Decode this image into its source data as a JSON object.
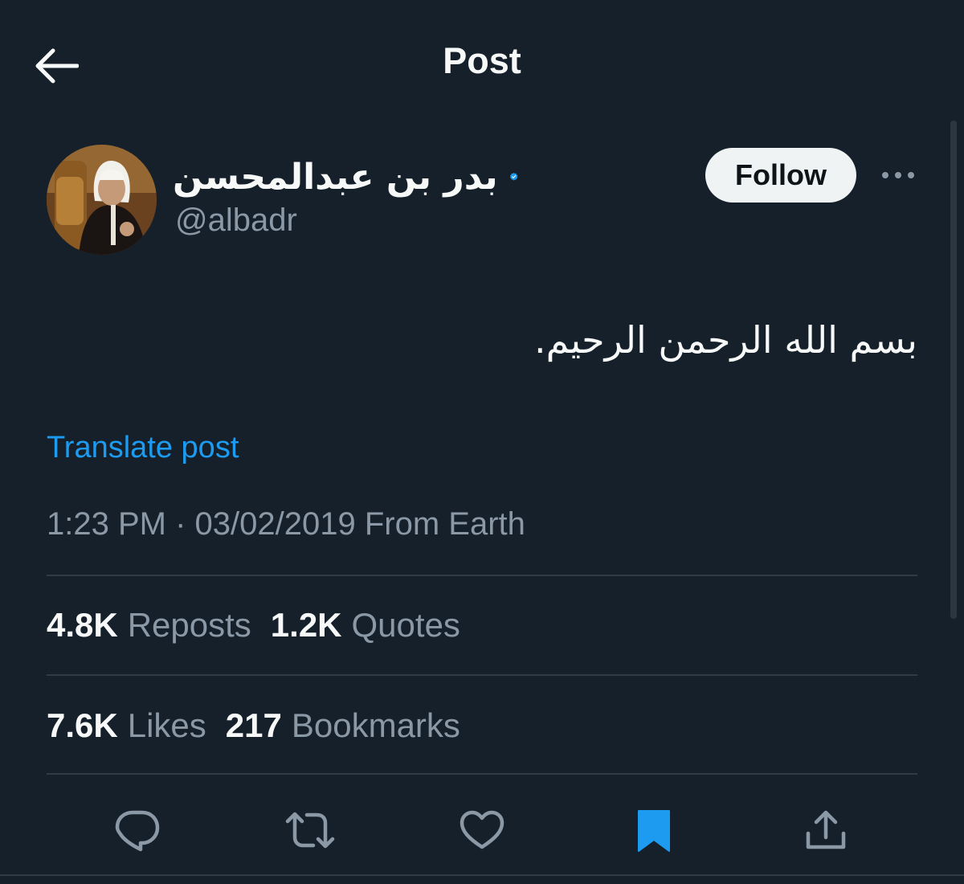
{
  "header": {
    "title": "Post"
  },
  "author": {
    "display_name": "بدر بن عبدالمحسن",
    "handle": "@albadr",
    "verified": true,
    "verified_color": "#1d9bf0"
  },
  "follow_label": "Follow",
  "post": {
    "text": "بسم الله الرحمن الرحيم.",
    "translate_label": "Translate post",
    "time": "1:23 PM",
    "separator": "·",
    "date": "03/02/2019",
    "source": "From Earth"
  },
  "stats": {
    "reposts_count": "4.8K",
    "reposts_label": "Reposts",
    "quotes_count": "1.2K",
    "quotes_label": "Quotes",
    "likes_count": "7.6K",
    "likes_label": "Likes",
    "bookmarks_count": "217",
    "bookmarks_label": "Bookmarks"
  },
  "actions": [
    "reply-icon",
    "repost-icon",
    "like-icon",
    "bookmark-icon",
    "share-icon"
  ],
  "colors": {
    "background": "#15202b",
    "accent": "#1d9bf0",
    "text_primary": "#f7f9f9",
    "text_secondary": "#8b98a5",
    "bookmark_active": "#1d9bf0"
  }
}
